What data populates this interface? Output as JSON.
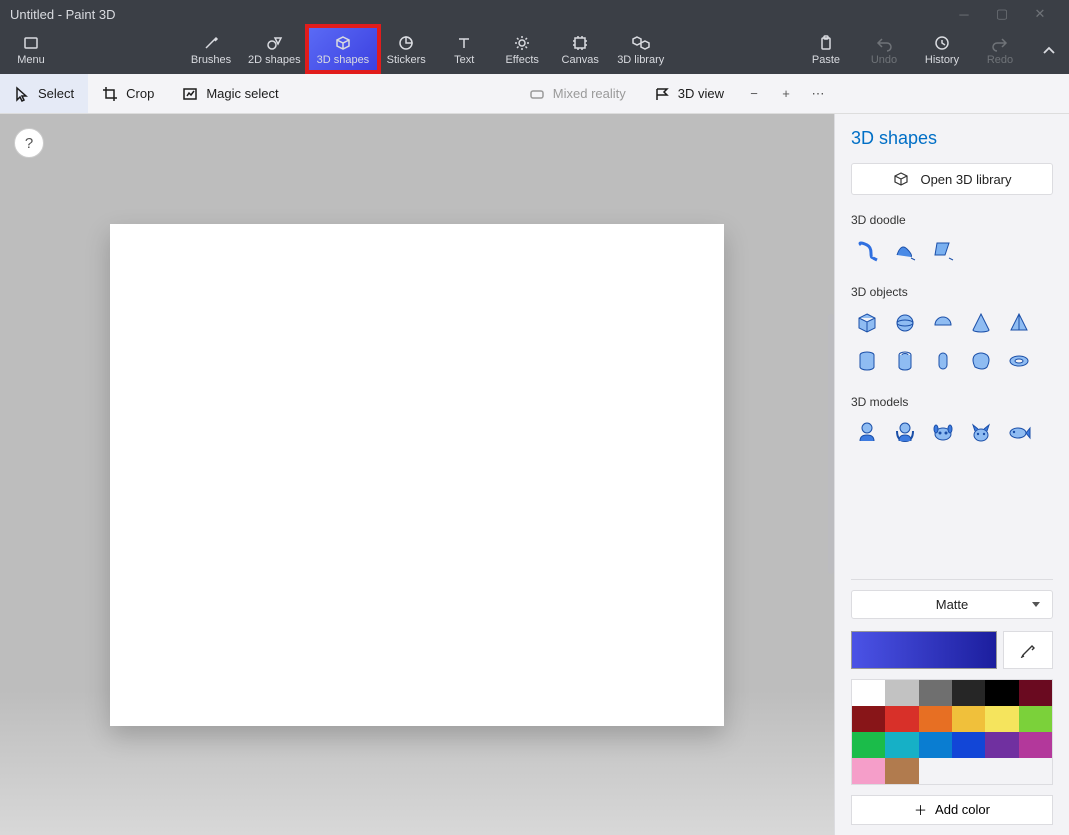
{
  "window": {
    "title": "Untitled - Paint 3D"
  },
  "ribbon": {
    "menu": "Menu",
    "tools": [
      {
        "label": "Brushes",
        "icon": "brush"
      },
      {
        "label": "2D shapes",
        "icon": "shapes2d"
      },
      {
        "label": "3D shapes",
        "icon": "cube",
        "selected": true,
        "highlighted": true
      },
      {
        "label": "Stickers",
        "icon": "sticker"
      },
      {
        "label": "Text",
        "icon": "text"
      },
      {
        "label": "Effects",
        "icon": "effects"
      },
      {
        "label": "Canvas",
        "icon": "canvas"
      },
      {
        "label": "3D library",
        "icon": "library"
      }
    ],
    "right": [
      {
        "label": "Paste",
        "icon": "paste",
        "disabled": false
      },
      {
        "label": "Undo",
        "icon": "undo",
        "disabled": true
      },
      {
        "label": "History",
        "icon": "history",
        "disabled": false
      },
      {
        "label": "Redo",
        "icon": "redo",
        "disabled": true
      }
    ]
  },
  "subbar": {
    "select": "Select",
    "crop": "Crop",
    "magic": "Magic select",
    "mixed": "Mixed reality",
    "view3d": "3D view"
  },
  "panel": {
    "title": "3D shapes",
    "open_library": "Open 3D library",
    "doodle": "3D doodle",
    "objects": "3D objects",
    "models": "3D models",
    "material": "Matte",
    "addcolor": "Add color",
    "current_color_gradient": [
      "#4b53e6",
      "#1c1e9e"
    ],
    "palette": [
      "#ffffff",
      "#c2c2c2",
      "#6f6f6f",
      "#262626",
      "#000000",
      "#6a0a20",
      "#881518",
      "#d83029",
      "#e76f23",
      "#f0c03b",
      "#f5e45d",
      "#7bd13a",
      "#1bbc4a",
      "#16b0c6",
      "#0a7dd1",
      "#1246d7",
      "#7030a0",
      "#b3389b",
      "#f59ec9",
      "#b17b4e"
    ],
    "palette_last_row_start": 18
  }
}
